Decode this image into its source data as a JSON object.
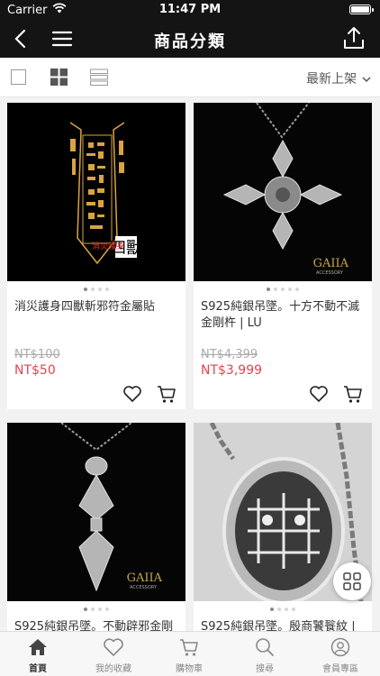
{
  "status": {
    "carrier": "Carrier",
    "time": "11:47 PM"
  },
  "nav": {
    "title": "商品分類"
  },
  "toolbar": {
    "sort_label": "最新上架"
  },
  "products": [
    {
      "name": "消災護身四獸斬邪符金屬貼",
      "original_price": "NT$100",
      "price": "NT$50",
      "image_text": "四獸",
      "image_sub": "消災護身"
    },
    {
      "name": "S925純銀吊墜。十方不動不滅金剛杵 | LU",
      "original_price": "NT$4,399",
      "price": "NT$3,999",
      "brand": "GAIIA",
      "brand_sub": "ACCESSORY"
    },
    {
      "name": "S925純銀吊墜。不動辟邪金剛",
      "brand": "GAIIA",
      "brand_sub": "ACCESSORY"
    },
    {
      "name": "S925純銀吊墜。殷商饕餮紋 |"
    }
  ],
  "tabs": [
    {
      "label": "首頁",
      "icon": "home-icon"
    },
    {
      "label": "我的收藏",
      "icon": "heart-icon"
    },
    {
      "label": "購物車",
      "icon": "cart-icon"
    },
    {
      "label": "搜尋",
      "icon": "search-icon"
    },
    {
      "label": "會員專區",
      "icon": "user-icon"
    }
  ],
  "colors": {
    "header_bg": "#141414",
    "price_red": "#e8424e",
    "gold": "#d9a441"
  }
}
